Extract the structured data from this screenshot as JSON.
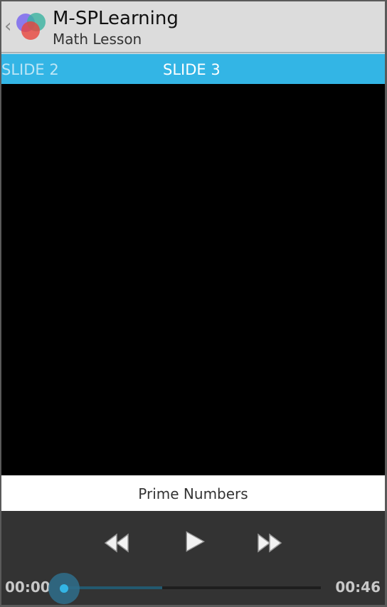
{
  "app": {
    "title": "M-SPLearning",
    "subtitle": "Math Lesson",
    "back_icon": "chevron-left-icon",
    "logo_icon": "overlapping-circles-logo-icon"
  },
  "pager": {
    "prev_tab": "SLIDE 2",
    "current_tab": "SLIDE 3",
    "accent_color": "#33b5e5"
  },
  "slide": {
    "caption": "Prime Numbers"
  },
  "player": {
    "rewind_icon": "rewind-icon",
    "play_icon": "play-icon",
    "fast_forward_icon": "fast-forward-icon",
    "elapsed": "00:00",
    "total": "00:46",
    "progress": 0.0,
    "buffered": 0.38
  }
}
